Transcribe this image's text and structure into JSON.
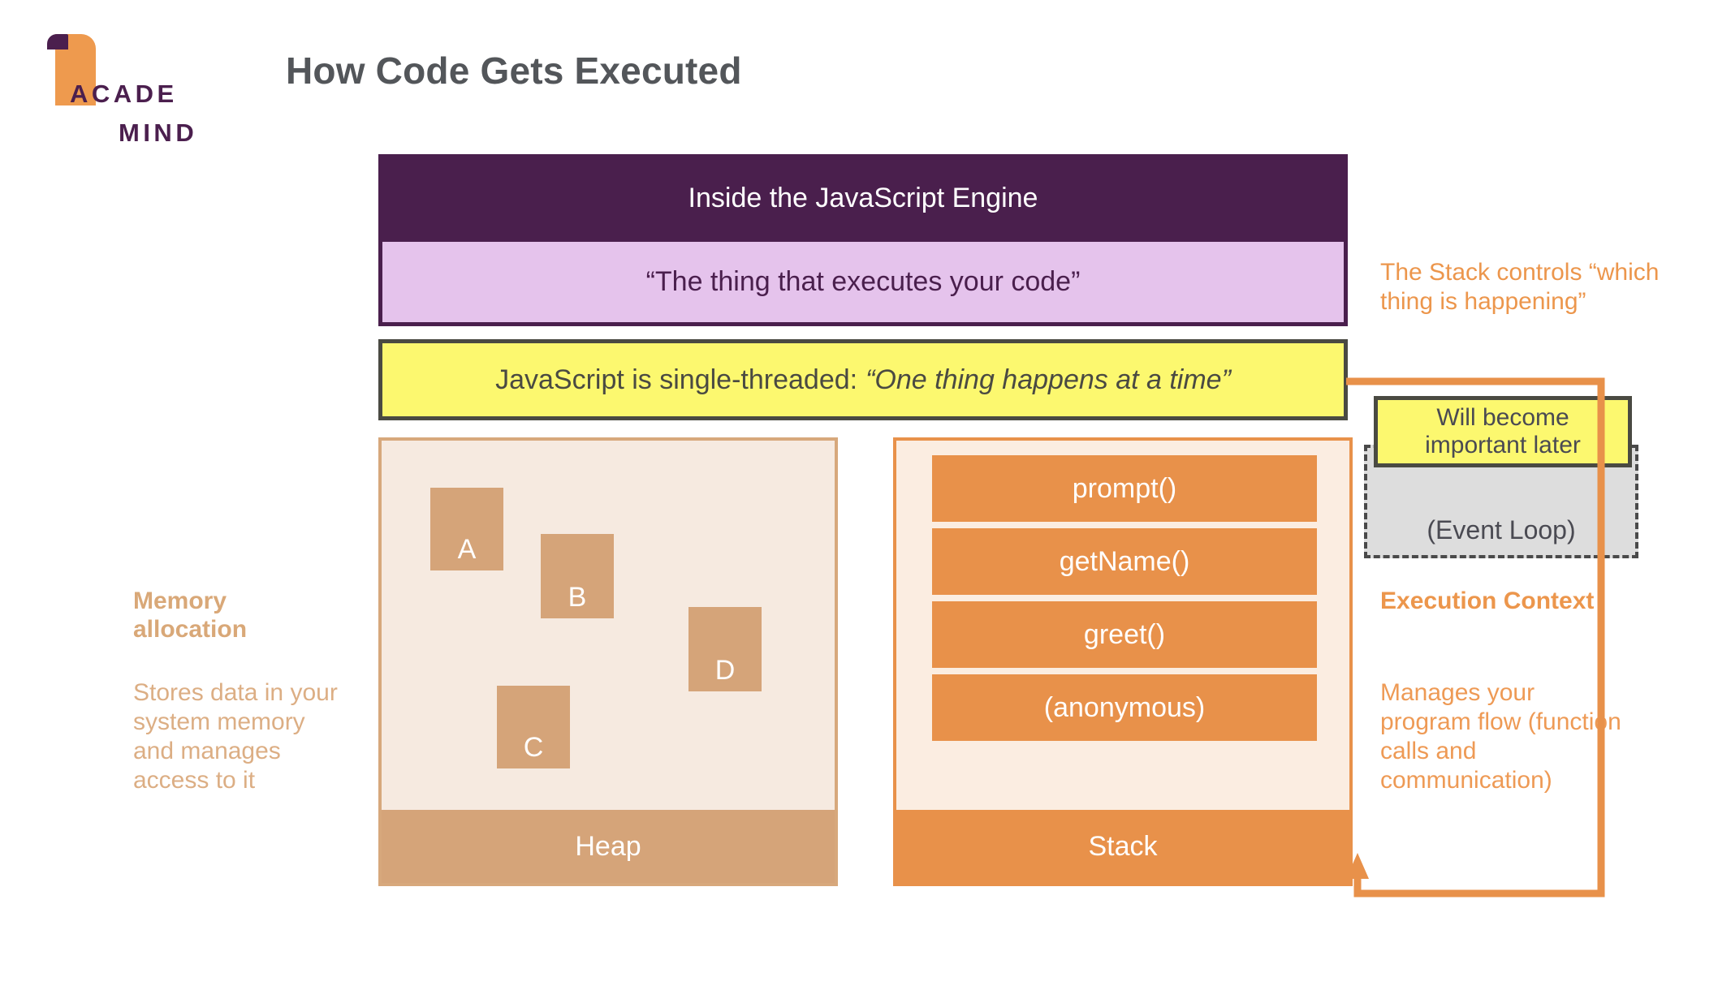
{
  "logo": {
    "line1": "ACADE",
    "line2": "MIND",
    "mark": "bookmark-flag-icon"
  },
  "title": "How Code Gets Executed",
  "bands": {
    "engine": "Inside the JavaScript Engine",
    "quote": "“The thing that executes your code”",
    "threaded_prefix": "JavaScript is single-threaded:",
    "threaded_em": "“One thing happens at a time”"
  },
  "heap": {
    "footer": "Heap",
    "blocks": [
      {
        "label": "A"
      },
      {
        "label": "B"
      },
      {
        "label": "C"
      },
      {
        "label": "D"
      }
    ]
  },
  "stack": {
    "footer": "Stack",
    "frames": [
      {
        "label": "prompt()"
      },
      {
        "label": "getName()"
      },
      {
        "label": "greet()"
      },
      {
        "label": "(anonymous)"
      }
    ]
  },
  "memory": {
    "heading": "Memory allocation",
    "body": "Stores data in your system memory and manages access to it"
  },
  "execution": {
    "heading": "Execution Context",
    "body": "Manages your program flow (function calls and communication)"
  },
  "stack_controls": "The Stack controls “which thing is happening”",
  "event_loop": {
    "label": "(Event Loop)",
    "callout_line1": "Will become",
    "callout_line2": "important later"
  },
  "colors": {
    "dark_purple": "#4A1F4D",
    "lavender": "#E5C3EC",
    "yellow": "#FCF86F",
    "orange": "#E8914A",
    "orange_text": "#EC964C",
    "tan": "#D5A479",
    "tan_text": "#D9A878",
    "heap_bg": "#F6EAE0",
    "stack_bg": "#FBEDE1",
    "title_gray": "#53565A",
    "outline_gray": "#4A4A42",
    "event_loop_gray": "#DDDDDD"
  }
}
